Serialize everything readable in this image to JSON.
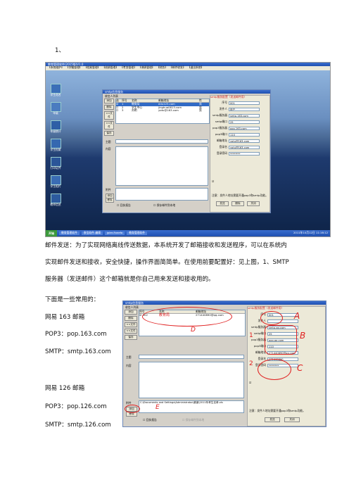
{
  "doc": {
    "item_number": "1、",
    "para_line1": "邮件发送：为了实现网络离线传送数据，本系统开发了邮箱接收和发送程序，可以在系统内",
    "para_line2": "实现邮件发送和接收，安全快捷，操作界面简简单。在使用前要配置好：见上图，1、SMTP",
    "para_line3": "服务器（发送邮件）这个邮箱就是你自己用来发送和接收用的。",
    "common_intro": "下面是一些常用的：",
    "providers": [
      {
        "name": "网易 163 邮箱",
        "pop3": "POP3：pop.163.com",
        "smtp": "SMTP：smtp.163.com"
      },
      {
        "name": "网易 126 邮箱",
        "pop3": "POP3：pop.126.com",
        "smtp": "SMTP：smtp.126.com"
      }
    ]
  },
  "screenshot1": {
    "app_title": "教育管理软件(2015版)V1.0",
    "menu": [
      "【系统维护】",
      "【学籍管理】",
      "【档案管理】",
      "【成绩管理】",
      "【考务管理】",
      "【课表管理】",
      "【财务】",
      "【邮件收发】",
      "【退出系统】"
    ],
    "side_items": [
      "学生花名",
      "年级",
      "年级统计",
      "学生档案",
      "打印证件",
      "学生相片",
      "教师信息"
    ],
    "dialog_title": "smtp信息服务",
    "receiver_label": "收信人列表",
    "table_headers": [
      "选",
      "序号",
      "名称",
      "邮箱地址",
      "性"
    ],
    "rows": [
      [
        "1",
        "教育局",
        "edu123.com",
        "男"
      ],
      [
        "2",
        "学生中心",
        "jinghua0813.com",
        "男"
      ],
      [
        "3",
        "刘明",
        "yotu@163.com",
        "男"
      ]
    ],
    "left_buttons": [
      "添加",
      "删除",
      "<<文件",
      "<<文件",
      "保存"
    ],
    "subject_label": "主题",
    "content_label": "内容",
    "attachment_label": "附件",
    "add_label": "添加",
    "remove_label": "移除",
    "checkbox_receipt": "回执报告",
    "checkbox_html": "保存邮件到本地",
    "right_title": "smtp服务配置（发送邮件用）",
    "right_fields": [
      {
        "label": "序号",
        "value": "001"
      },
      {
        "label": "发件人",
        "value": "用户"
      },
      {
        "label": "smtp服务器",
        "value": "smtp.163.com"
      },
      {
        "label": "smtp端口",
        "value": "25"
      },
      {
        "label": "pop3服务器",
        "value": "pop.163.com"
      },
      {
        "label": "pop3端口",
        "value": "110"
      },
      {
        "label": "邮箱地址",
        "value": "yotu@163.com"
      },
      {
        "label": "登录名",
        "value": "yotu@163.com"
      },
      {
        "label": "登录密码",
        "value": "********"
      }
    ],
    "right_check": "服务器需要身份验证",
    "note": "注意：发件人地址需要开通pop3和smtp功能。",
    "bottom_buttons": [
      "发送",
      "删除",
      "关闭"
    ],
    "taskbar_start": "开始",
    "taskbar_items": [
      "教育管理软件",
      "收信软件-编辑",
      "jpler-Fonefo",
      "教育管理软件"
    ],
    "clock": "2011年10月12日 11:16:12"
  },
  "screenshot2": {
    "dialog_title": "smtp信息服务",
    "receiver_label": "收信人列表",
    "table_headers": [
      "序号",
      "名称",
      "邮箱地址"
    ],
    "row": [
      "002",
      "教育局",
      "271440890@qq.com"
    ],
    "left_buttons": [
      "添加",
      "删除",
      "<<文件",
      "<<文件",
      "保存"
    ],
    "subject_label": "主题",
    "content_label": "内容",
    "attachment_label": "附件",
    "attachment_path": "C:\\Documents and Settings\\Administrator\\桌面\\2011年考生名单.xls",
    "add_label": "添加",
    "remove_label": "移除",
    "checkbox_receipt": "回执报告",
    "checkbox_html": "保存邮件到本地",
    "right_title": "smtp服务配置（发送邮件用）",
    "right_fields": [
      {
        "label": "序号",
        "value": "001"
      },
      {
        "label": "发件人",
        "value": ""
      },
      {
        "label": "smtp服务器",
        "value": "smtp.qq.com"
      },
      {
        "label": "smtp端口",
        "value": "25"
      },
      {
        "label": "pop3服务器",
        "value": "pop.qq.com"
      },
      {
        "label": "pop3端口",
        "value": "110"
      },
      {
        "label": "邮箱地址",
        "value": "271440890@qq.com"
      },
      {
        "label": "登录名",
        "value": "271440890"
      },
      {
        "label": "登录密码",
        "value": "********"
      }
    ],
    "right_check": "服务器需要身份验证",
    "note": "注意：发件人地址需要开通pop3和smtp功能。",
    "bottom_buttons": [
      "发送",
      "关闭"
    ],
    "annotation_letters": [
      "A",
      "B",
      "C",
      "D",
      "E"
    ],
    "annotation_numbers": [
      "1",
      "2"
    ]
  },
  "colors": {
    "desktop_sky": "#8fb3dc",
    "desktop_water": "#1e3a6e",
    "title_blue": "#2050b0",
    "annotation_red": "#e02020"
  }
}
